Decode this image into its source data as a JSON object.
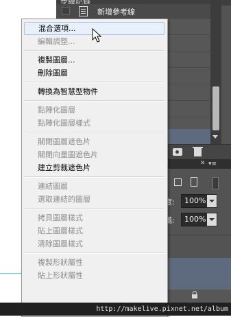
{
  "history_panel": {
    "title": "步驟記錄",
    "item_label": "新增參考線"
  },
  "layers_panel": {
    "opacity_label": "度:",
    "opacity_value": "100%",
    "fill_label": "滿:",
    "fill_value": "100%"
  },
  "context_menu": {
    "groups": [
      [
        {
          "label": "混合選項...",
          "enabled": true,
          "hover": true
        },
        {
          "label": "編輯調整...",
          "enabled": false
        }
      ],
      [
        {
          "label": "複製圖層...",
          "enabled": true
        },
        {
          "label": "刪除圖層",
          "enabled": true
        }
      ],
      [
        {
          "label": "轉換為智慧型物件",
          "enabled": true
        }
      ],
      [
        {
          "label": "點陣化圖層",
          "enabled": false
        },
        {
          "label": "點陣化圖層樣式",
          "enabled": false
        }
      ],
      [
        {
          "label": "關閉圖層遮色片",
          "enabled": false
        },
        {
          "label": "關閉向量圖遮色片",
          "enabled": false
        },
        {
          "label": "建立剪裁遮色片",
          "enabled": true
        }
      ],
      [
        {
          "label": "連結圖層",
          "enabled": false
        },
        {
          "label": "選取連結的圖層",
          "enabled": false
        }
      ],
      [
        {
          "label": "拷貝圖層樣式",
          "enabled": false
        },
        {
          "label": "貼上圖層樣式",
          "enabled": false
        },
        {
          "label": "清除圖層樣式",
          "enabled": false
        }
      ],
      [
        {
          "label": "複製形狀屬性",
          "enabled": false
        },
        {
          "label": "貼上形狀屬性",
          "enabled": false
        }
      ]
    ]
  },
  "watermark": "http://makelive.pixnet.net/album"
}
